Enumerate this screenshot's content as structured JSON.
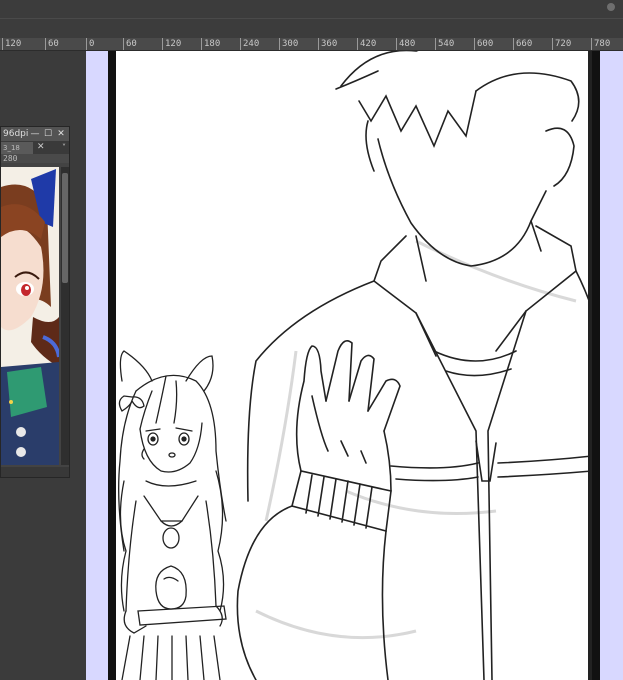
{
  "ruler": {
    "labels": [
      "120",
      "60",
      "0",
      "60",
      "120",
      "180",
      "240",
      "300",
      "360",
      "420",
      "480",
      "540",
      "600",
      "660",
      "720",
      "780"
    ]
  },
  "document_panel": {
    "title": "96dpi",
    "tab": "3_18",
    "ruler_value": "280",
    "window_buttons": {
      "minimize": "—",
      "maximize": "☐",
      "close": "✕"
    },
    "tab_close": "✕",
    "tab_menu": "˅"
  },
  "icons": [
    "minimize-icon",
    "maximize-icon",
    "close-icon",
    "tab-close-icon",
    "chevron-down-icon"
  ],
  "colors": {
    "app_bg": "#3a3a3a",
    "pasteboard": "#d8d8ff",
    "canvas_border": "#111111",
    "paper": "#ffffff"
  }
}
